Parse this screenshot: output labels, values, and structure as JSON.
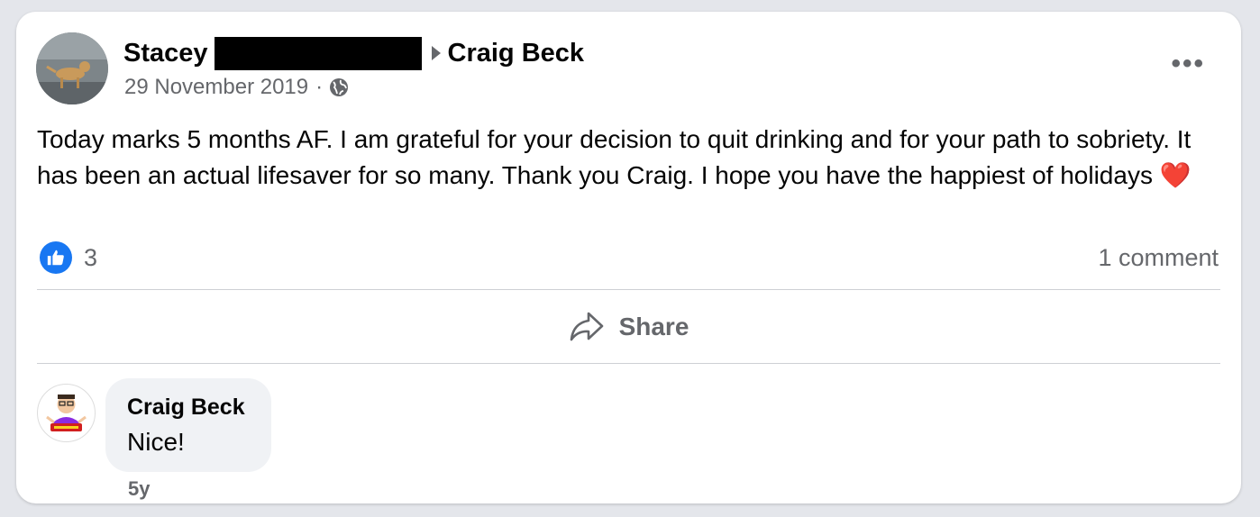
{
  "post": {
    "author": "Stacey",
    "target": "Craig Beck",
    "date": "29 November 2019",
    "separator": "·",
    "privacy_icon": "globe-icon",
    "more_label": "•••",
    "text": "Today marks 5 months AF. I am grateful for your decision to quit drinking and for your path to sobriety. It has been an actual lifesaver for so many. Thank you Craig. I hope you have the happiest of holidays",
    "emoji": "❤️",
    "reaction_icon": "like-icon",
    "reaction_count": "3",
    "comment_count": "1 comment"
  },
  "actions": {
    "share_label": "Share",
    "share_icon": "share-arrow-icon"
  },
  "comment": {
    "author": "Craig Beck",
    "text": "Nice!",
    "age": "5y"
  },
  "colors": {
    "like_blue": "#1877f2",
    "secondary_text": "#65676b",
    "bubble_bg": "#f0f2f5",
    "heart_red": "#e41e3f"
  }
}
